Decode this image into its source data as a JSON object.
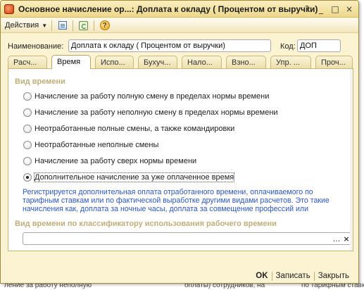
{
  "window": {
    "title": "Основное начисление ор...: Доплата к окладу ( Процентом от выручки)"
  },
  "title_buttons": {
    "help": "?",
    "minimize": "_",
    "maximize": "□",
    "close": "×"
  },
  "toolbar": {
    "actions_label": "Действия",
    "help_icon": "?"
  },
  "form": {
    "name_label": "Наименование:",
    "name_value": "Доплата к окладу ( Процентом от выручки)",
    "code_label": "Код:",
    "code_value": "ДОП"
  },
  "tabs": [
    {
      "label": "Расч...",
      "active": false
    },
    {
      "label": "Время",
      "active": true
    },
    {
      "label": "Испо...",
      "active": false
    },
    {
      "label": "Бухуч...",
      "active": false
    },
    {
      "label": "Нало...",
      "active": false
    },
    {
      "label": "Взно...",
      "active": false
    },
    {
      "label": "Упр. ...",
      "active": false
    },
    {
      "label": "Проч...",
      "active": false
    }
  ],
  "time_section": {
    "title": "Вид времени",
    "options": [
      {
        "label": "Начисление за работу полную смену в пределах нормы времени",
        "checked": false
      },
      {
        "label": "Начисление за работу неполную смену в пределах нормы времени",
        "checked": false
      },
      {
        "label": "Неотработанные полные смены, а также командировки",
        "checked": false
      },
      {
        "label": "Неотработанные неполные смены",
        "checked": false
      },
      {
        "label": "Начисление за работу сверх нормы времени",
        "checked": false
      },
      {
        "label": "Дополнительное начисление за уже оплаченное время",
        "checked": true
      }
    ],
    "description": "Регистрируется дополнительная оплата отработанного времени, оплачиваемого по тарифным ставкам или по фактической выработке другими видами расчетов. Это такие начисления как, доплата за ночные часы, доплата за совмещение профессий или"
  },
  "classifier_section": {
    "title": "Вид времени по классификатору использования рабочего времени",
    "value": "",
    "select_button": "...",
    "clear_button": "×"
  },
  "footer": {
    "ok": "OK",
    "save": "Записать",
    "close": "Закрыть"
  },
  "behind_text": {
    "left": "ление за работу неполную",
    "middle": "оплаты) сотрудников, на",
    "right": "по тарифным ставкам или по"
  }
}
